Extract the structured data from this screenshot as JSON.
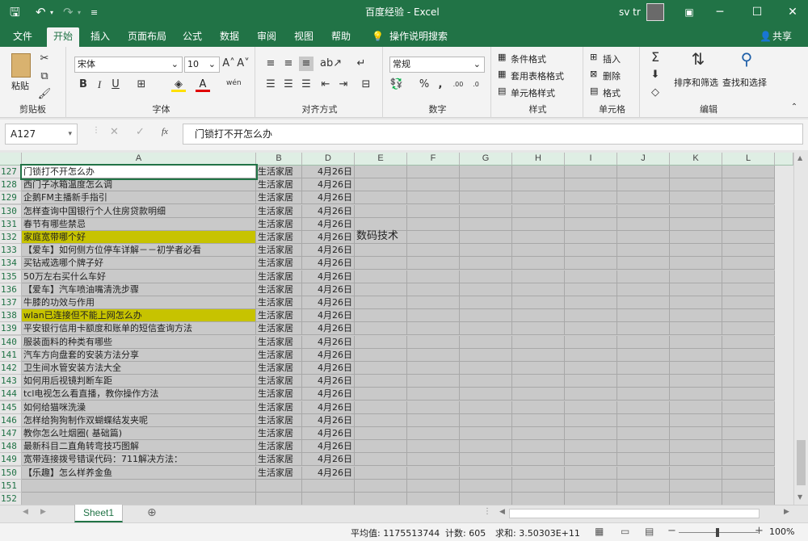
{
  "window": {
    "title": "百度经验  -  Excel",
    "user": "sv tr",
    "share_label": "共享",
    "tell_me": "操作说明搜索"
  },
  "tabs": [
    "文件",
    "开始",
    "插入",
    "页面布局",
    "公式",
    "数据",
    "审阅",
    "视图",
    "帮助"
  ],
  "ribbon": {
    "clipboard": {
      "label": "剪贴板",
      "paste": "粘贴"
    },
    "font": {
      "label": "字体",
      "name": "宋体",
      "size": "10",
      "bold": "B",
      "italic": "I",
      "underline": "U",
      "wen": "wén"
    },
    "alignment": {
      "label": "对齐方式"
    },
    "number": {
      "label": "数字",
      "format": "常规"
    },
    "styles": {
      "label": "样式",
      "cond": "条件格式",
      "table": "套用表格格式",
      "cell": "单元格样式"
    },
    "cells": {
      "label": "单元格",
      "insert": "插入",
      "delete": "删除",
      "format": "格式"
    },
    "editing": {
      "label": "编辑",
      "sort": "排序和筛选",
      "find": "查找和选择"
    }
  },
  "formula_bar": {
    "namebox": "A127",
    "fx": "fx",
    "value": "门锁打不开怎么办"
  },
  "columns": [
    "A",
    "B",
    "D",
    "E",
    "F",
    "G",
    "H",
    "I",
    "J",
    "K",
    "L"
  ],
  "rows": [
    {
      "num": "127",
      "a": "门锁打不开怎么办",
      "b": "生活家居",
      "d": "4月26日",
      "e": "",
      "hl": false,
      "sel": true
    },
    {
      "num": "128",
      "a": "西门子冰箱温度怎么调",
      "b": "生活家居",
      "d": "4月26日",
      "e": "",
      "hl": false
    },
    {
      "num": "129",
      "a": "企鹅FM主播新手指引",
      "b": "生活家居",
      "d": "4月26日",
      "e": "",
      "hl": false
    },
    {
      "num": "130",
      "a": "怎样查询中国银行个人住房贷款明细",
      "b": "生活家居",
      "d": "4月26日",
      "e": "",
      "hl": false
    },
    {
      "num": "131",
      "a": "春节有哪些禁忌",
      "b": "生活家居",
      "d": "4月26日",
      "e": "",
      "hl": false
    },
    {
      "num": "132",
      "a": "家庭宽带哪个好",
      "b": "生活家居",
      "d": "4月26日",
      "e": "数码技术",
      "hl": true
    },
    {
      "num": "133",
      "a": "【爱车】如何侧方位停车详解－－初学者必看",
      "b": "生活家居",
      "d": "4月26日",
      "e": "",
      "hl": false
    },
    {
      "num": "134",
      "a": "买钻戒选哪个牌子好",
      "b": "生活家居",
      "d": "4月26日",
      "e": "",
      "hl": false
    },
    {
      "num": "135",
      "a": "50万左右买什么车好",
      "b": "生活家居",
      "d": "4月26日",
      "e": "",
      "hl": false
    },
    {
      "num": "136",
      "a": "【爱车】汽车喷油嘴清洗步骤",
      "b": "生活家居",
      "d": "4月26日",
      "e": "",
      "hl": false
    },
    {
      "num": "137",
      "a": "牛膝的功效与作用",
      "b": "生活家居",
      "d": "4月26日",
      "e": "",
      "hl": false
    },
    {
      "num": "138",
      "a": "wlan已连接但不能上网怎么办",
      "b": "生活家居",
      "d": "4月26日",
      "e": "",
      "hl": true
    },
    {
      "num": "139",
      "a": "平安银行信用卡额度和账单的短信查询方法",
      "b": "生活家居",
      "d": "4月26日",
      "e": "",
      "hl": false
    },
    {
      "num": "140",
      "a": "服装面料的种类有哪些",
      "b": "生活家居",
      "d": "4月26日",
      "e": "",
      "hl": false
    },
    {
      "num": "141",
      "a": "汽车方向盘套的安装方法分享",
      "b": "生活家居",
      "d": "4月26日",
      "e": "",
      "hl": false
    },
    {
      "num": "142",
      "a": "卫生间水管安装方法大全",
      "b": "生活家居",
      "d": "4月26日",
      "e": "",
      "hl": false
    },
    {
      "num": "143",
      "a": "如何用后视镜判断车距",
      "b": "生活家居",
      "d": "4月26日",
      "e": "",
      "hl": false
    },
    {
      "num": "144",
      "a": "tcl电视怎么看直播，教你操作方法",
      "b": "生活家居",
      "d": "4月26日",
      "e": "",
      "hl": false
    },
    {
      "num": "145",
      "a": "如何给猫咪洗澡",
      "b": "生活家居",
      "d": "4月26日",
      "e": "",
      "hl": false
    },
    {
      "num": "146",
      "a": "怎样给狗狗制作双蝴蝶结发夹呢",
      "b": "生活家居",
      "d": "4月26日",
      "e": "",
      "hl": false
    },
    {
      "num": "147",
      "a": "教你怎么吐烟圈( 基础篇)",
      "b": "生活家居",
      "d": "4月26日",
      "e": "",
      "hl": false
    },
    {
      "num": "148",
      "a": "最新科目二直角转弯技巧图解",
      "b": "生活家居",
      "d": "4月26日",
      "e": "",
      "hl": false
    },
    {
      "num": "149",
      "a": "宽带连接拨号错误代码：711解决方法：",
      "b": "生活家居",
      "d": "4月26日",
      "e": "",
      "hl": false
    },
    {
      "num": "150",
      "a": "【乐趣】怎么样养金鱼",
      "b": "生活家居",
      "d": "4月26日",
      "e": "",
      "hl": false
    },
    {
      "num": "151",
      "a": "",
      "b": "",
      "d": "",
      "e": "",
      "hl": false
    },
    {
      "num": "152",
      "a": "",
      "b": "",
      "d": "",
      "e": "",
      "hl": false
    }
  ],
  "sheet_tab": "Sheet1",
  "status": {
    "avg": "平均值: 1175513744",
    "count": "计数: 605",
    "sum": "求和: 3.50303E+11",
    "zoom": "100%"
  },
  "colors": {
    "accent": "#217346",
    "highlight": "#c7c300",
    "selection": "#c9c9c9"
  }
}
